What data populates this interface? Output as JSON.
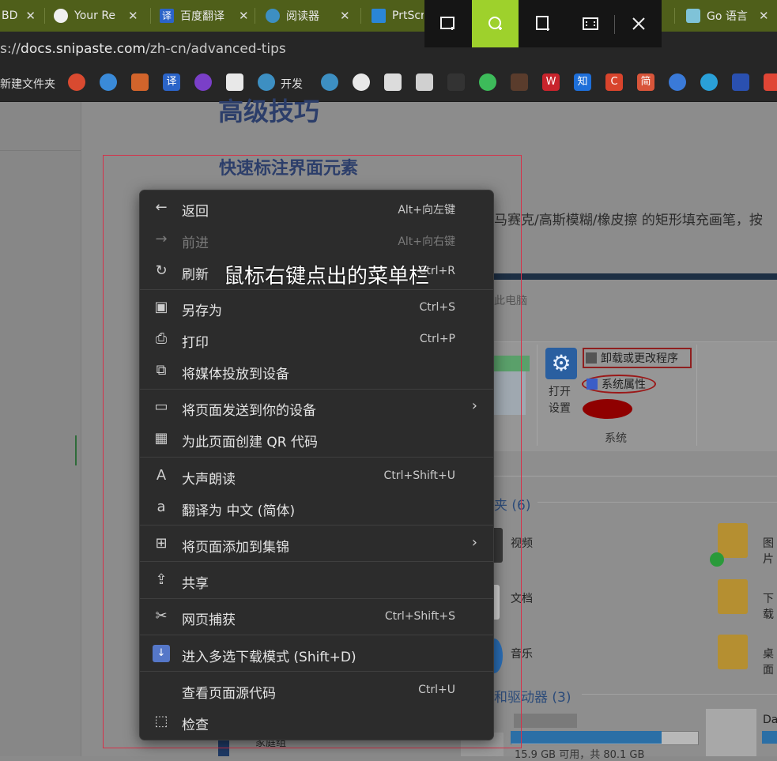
{
  "tabs": [
    {
      "title": "BD",
      "icon": "tab-favicon-icon"
    },
    {
      "title": "Your Re",
      "icon": "github-icon"
    },
    {
      "title": "百度翻译",
      "icon": "baidu-translate-icon"
    },
    {
      "title": "阅读器",
      "icon": "reader-icon"
    },
    {
      "title": "PrtScr",
      "icon": "bing-icon"
    },
    {
      "title": "Go 语言",
      "icon": "go-icon"
    }
  ],
  "address": {
    "prefix": "s://",
    "host": "docs.snipaste.com",
    "path": "/zh-cn/advanced-tips"
  },
  "bookmarks": {
    "new_folder": "新建文件夹",
    "kaifa": "开发",
    "zhi": "知",
    "jian": "简"
  },
  "page": {
    "title": "高级技巧",
    "h2": "快速标注界面元素",
    "text": "马赛克/高斯模糊/橡皮擦 的矩形填充画笔，按"
  },
  "embedded": {
    "pc_label": "此电脑",
    "open_settings": "打开设置",
    "uninstall": "卸载或更改程序",
    "sys_props": "系统属性",
    "system": "系统",
    "folders_heading": "夹 (6)",
    "drives_heading": "和驱动器 (3)",
    "video": "视频",
    "docs": "文档",
    "music": "音乐",
    "pics": "图片",
    "download": "下载",
    "desktop": "桌面",
    "disk1_free": "15.9 GB 可用，共 80.1 GB",
    "disk1_fill": 0.81,
    "disk2_label": "Da",
    "bottom_text": "家庭组"
  },
  "snipaste_toolbar": [
    "rect-capture-icon",
    "ellipse-capture-icon",
    "crop-capture-icon",
    "fullscreen-icon",
    "close-icon"
  ],
  "annotation": "鼠标右键点出的菜单栏",
  "menu": {
    "back": {
      "label": "返回",
      "shortcut": "Alt+向左键"
    },
    "forward": {
      "label": "前进",
      "shortcut": "Alt+向右键"
    },
    "refresh": {
      "label": "刷新",
      "shortcut": "Ctrl+R"
    },
    "save_as": {
      "label": "另存为",
      "shortcut": "Ctrl+S"
    },
    "print": {
      "label": "打印",
      "shortcut": "Ctrl+P"
    },
    "cast": {
      "label": "将媒体投放到设备"
    },
    "send": {
      "label": "将页面发送到你的设备"
    },
    "qr": {
      "label": "为此页面创建 QR 代码"
    },
    "read_aloud": {
      "label": "大声朗读",
      "shortcut": "Ctrl+Shift+U"
    },
    "translate": {
      "label": "翻译为 中文 (简体)"
    },
    "collections": {
      "label": "将页面添加到集锦"
    },
    "share": {
      "label": "共享"
    },
    "web_capture": {
      "label": "网页捕获",
      "shortcut": "Ctrl+Shift+S"
    },
    "multi_download": {
      "label": "进入多选下载模式 (Shift+D)"
    },
    "view_source": {
      "label": "查看页面源代码",
      "shortcut": "Ctrl+U"
    },
    "inspect": {
      "label": "检查"
    }
  }
}
